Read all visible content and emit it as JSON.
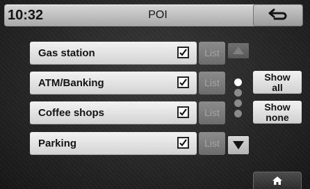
{
  "header": {
    "clock": "10:32",
    "title": "POI",
    "back_icon": "back-arrow-icon"
  },
  "poi_items": [
    {
      "label": "Gas station",
      "checked": true,
      "list_label": "List"
    },
    {
      "label": "ATM/Banking",
      "checked": true,
      "list_label": "List"
    },
    {
      "label": "Coffee shops",
      "checked": true,
      "list_label": "List"
    },
    {
      "label": "Parking",
      "checked": true,
      "list_label": "List"
    }
  ],
  "scroll": {
    "up_icon": "triangle-up-icon",
    "down_icon": "triangle-down-icon",
    "page_indicator_count": 4,
    "current_page": 1
  },
  "side_buttons": {
    "show_all": "Show\nall",
    "show_none": "Show\nnone"
  },
  "footer": {
    "home_icon": "home-icon"
  },
  "colors": {
    "background": "#262626",
    "button_light": "#e6e6e6",
    "list_button": "#7a7a7a",
    "list_text": "#a4a4a4",
    "dot_active": "#ffffff",
    "dot_inactive": "#8a8a8a"
  }
}
